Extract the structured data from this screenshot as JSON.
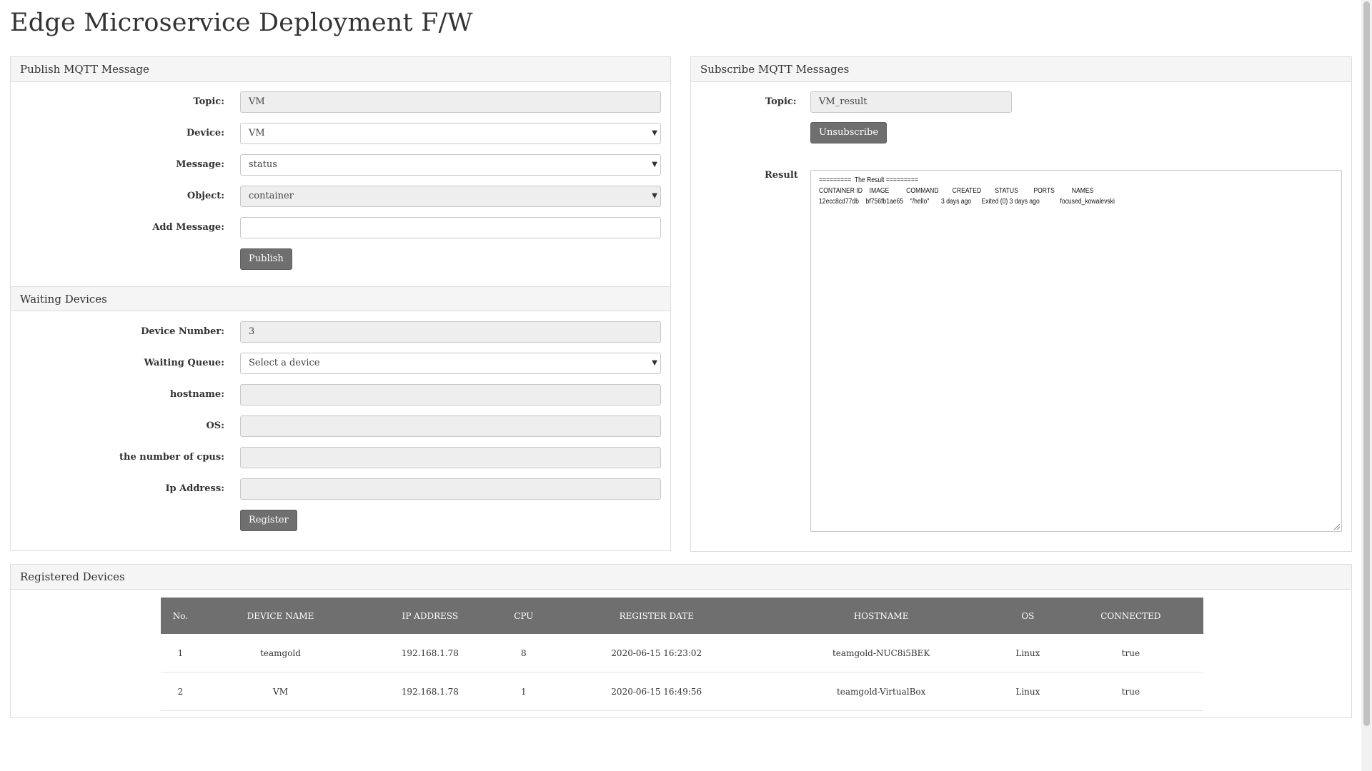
{
  "page": {
    "title": "Edge Microservice Deployment F/W"
  },
  "publish": {
    "header": "Publish MQTT Message",
    "topic_label": "Topic:",
    "topic_value": "VM",
    "device_label": "Device:",
    "device_value": "VM",
    "message_label": "Message:",
    "message_value": "status",
    "object_label": "Object:",
    "object_value": "container",
    "add_message_label": "Add Message:",
    "add_message_value": "",
    "publish_button": "Publish"
  },
  "waiting": {
    "header": "Waiting Devices",
    "device_number_label": "Device Number:",
    "device_number_value": "3",
    "queue_label": "Waiting Queue:",
    "queue_value": "Select a device",
    "hostname_label": "hostname:",
    "hostname_value": "",
    "os_label": "OS:",
    "os_value": "",
    "cpus_label": "the number of cpus:",
    "cpus_value": "",
    "ip_label": "Ip Address:",
    "ip_value": "",
    "register_button": "Register"
  },
  "subscribe": {
    "header": "Subscribe MQTT Messages",
    "topic_label": "Topic:",
    "topic_value": "VM_result",
    "unsubscribe_button": "Unsubscribe",
    "result_label": "Result",
    "result_lines": [
      "=========  The Result =========",
      "CONTAINER ID    IMAGE          COMMAND        CREATED        STATUS         PORTS          NAMES",
      "12ecc8cd77db    bf756fb1ae65    \"/hello\"       3 days ago      Exited (0) 3 days ago            focused_kowalevski"
    ]
  },
  "registered": {
    "header": "Registered Devices",
    "columns": [
      "No.",
      "DEVICE NAME",
      "IP ADDRESS",
      "CPU",
      "REGISTER DATE",
      "HOSTNAME",
      "OS",
      "CONNECTED"
    ],
    "rows": [
      [
        "1",
        "teamgold",
        "192.168.1.78",
        "8",
        "2020-06-15 16:23:02",
        "teamgold-NUC8i5BEK",
        "Linux",
        "true"
      ],
      [
        "2",
        "VM",
        "192.168.1.78",
        "1",
        "2020-06-15 16:49:56",
        "teamgold-VirtualBox",
        "Linux",
        "true"
      ]
    ]
  },
  "colors": {
    "button": "#6f6f6f",
    "panel_header": "#f5f5f5",
    "readonly_field": "#eeeeee",
    "table_header": "#6f6f6f"
  }
}
